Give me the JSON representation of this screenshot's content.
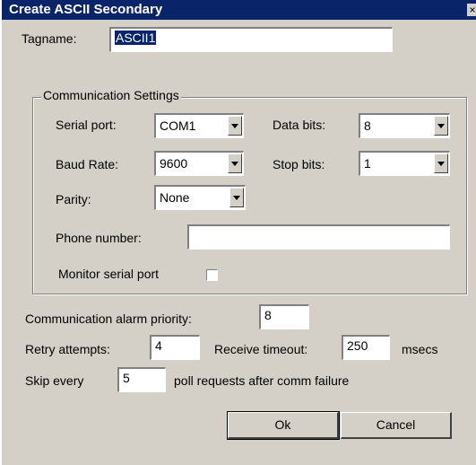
{
  "window": {
    "title": "Create ASCII Secondary",
    "close_glyph": "×"
  },
  "tagname": {
    "label": "Tagname:",
    "value": "ASCII1"
  },
  "comm_settings": {
    "legend": "Communication Settings",
    "serial_port": {
      "label": "Serial port:",
      "value": "COM1"
    },
    "data_bits": {
      "label": "Data bits:",
      "value": "8"
    },
    "baud_rate": {
      "label": "Baud Rate:",
      "value": "9600"
    },
    "stop_bits": {
      "label": "Stop bits:",
      "value": "1"
    },
    "parity": {
      "label": "Parity:",
      "value": "None"
    },
    "phone_number": {
      "label": "Phone number:",
      "value": ""
    },
    "monitor_serial_port": {
      "label": "Monitor serial port",
      "checked": false
    }
  },
  "alarm_priority": {
    "label": "Communication alarm priority:",
    "value": "8"
  },
  "retry": {
    "label": "Retry attempts:",
    "value": "4"
  },
  "receive_timeout": {
    "label": "Receive timeout:",
    "value": "250",
    "unit": "msecs"
  },
  "skip": {
    "label_pre": "Skip every",
    "value": "5",
    "label_post": "poll requests after comm failure"
  },
  "buttons": {
    "ok": "Ok",
    "cancel": "Cancel"
  }
}
